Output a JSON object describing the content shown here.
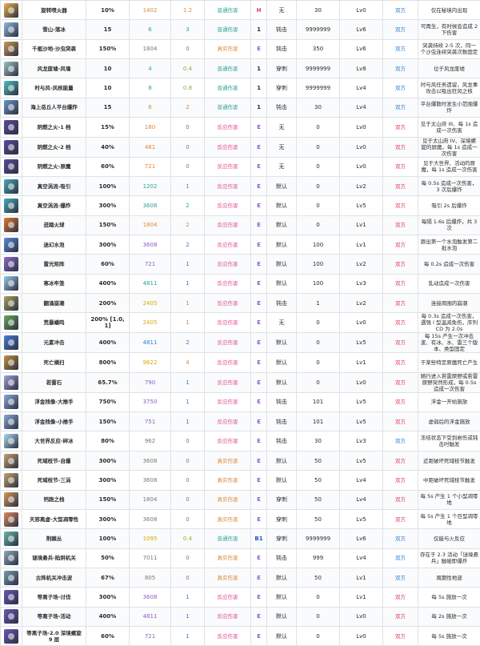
{
  "colors": {
    "orange": "#e0863a",
    "teal": "#2aa39a",
    "green": "#7cb342",
    "red": "#e0405a",
    "pink": "#e05290",
    "purple": "#8a5fc8",
    "blue": "#2f7fd8",
    "yellow": "#d9a800",
    "gray": "#777777",
    "black": "#2b2b2b",
    "darkblue": "#2a52be"
  },
  "rows": [
    {
      "icon": "fire-sparkle-icon",
      "iconColor": "#f0b050",
      "name": "旋转喷火器",
      "pct": "10%",
      "num": "1402",
      "numColor": "orange",
      "mult": "1.2",
      "multColor": "orange",
      "dmg": "普通伤害",
      "dmgColor": "teal",
      "elem": "H",
      "elemColor": "red",
      "hit": "无",
      "val": "30",
      "lv": "Lv0",
      "side": "双方",
      "sideColor": "blue",
      "note": "仅在秘境内出现"
    },
    {
      "icon": "snow-fall-icon",
      "iconColor": "#8fb8e0",
      "name": "雪山-落冰",
      "pct": "15",
      "num": "6",
      "numColor": "teal",
      "mult": "3",
      "multColor": "teal",
      "dmg": "普通伤害",
      "dmgColor": "teal",
      "elem": "1",
      "elemColor": "black",
      "hit": "钝击",
      "val": "9999999",
      "lv": "Lv6",
      "side": "双方",
      "sideColor": "blue",
      "note": "可再生，有时候会造成 2 下伤害"
    },
    {
      "icon": "sand-worm-icon",
      "iconColor": "#c89850",
      "name": "千柩沙地-沙虫突袭",
      "pct": "150%",
      "num": "1804",
      "numColor": "gray",
      "mult": "0",
      "multColor": "gray",
      "dmg": "真实伤害",
      "dmgColor": "orange",
      "elem": "E",
      "elemColor": "purple",
      "hit": "钝击",
      "val": "350",
      "lv": "Lv6",
      "side": "双方",
      "sideColor": "blue",
      "note": "突袭持续 2-5 次，同一个沙虫连续突袭次数固定"
    },
    {
      "icon": "wind-wall-icon",
      "iconColor": "#9ac4c0",
      "name": "风龙废墟-风墙",
      "pct": "10",
      "num": "4",
      "numColor": "teal",
      "mult": "0.4",
      "multColor": "green",
      "dmg": "普通伤害",
      "dmgColor": "teal",
      "elem": "1",
      "elemColor": "black",
      "hit": "穿刺",
      "val": "9999999",
      "lv": "Lv8",
      "side": "双方",
      "sideColor": "blue",
      "note": "位于风龙废墟"
    },
    {
      "icon": "wind-core-icon",
      "iconColor": "#4fc0c0",
      "name": "时与风-风核能量",
      "pct": "10",
      "num": "8",
      "numColor": "teal",
      "mult": "0.8",
      "multColor": "green",
      "dmg": "普通伤害",
      "dmgColor": "teal",
      "elem": "1",
      "elemColor": "black",
      "hit": "穿刺",
      "val": "9999999",
      "lv": "Lv4",
      "side": "双方",
      "sideColor": "blue",
      "note": "时与风任务遗留，风龙事攻击以吸出狂风之核"
    },
    {
      "icon": "sea-platform-icon",
      "iconColor": "#6a98c8",
      "name": "海上岳丘人平台爆炸",
      "pct": "15",
      "num": "6",
      "numColor": "orange",
      "mult": "2",
      "multColor": "orange",
      "dmg": "普通伤害",
      "dmgColor": "teal",
      "elem": "1",
      "elemColor": "black",
      "hit": "钝击",
      "val": "30",
      "lv": "Lv4",
      "side": "双方",
      "sideColor": "blue",
      "note": "平台爆散时发生小范围爆炸"
    },
    {
      "icon": "dark-fire-icon",
      "iconColor": "#5a4a9a",
      "name": "阴燃之火-1 档",
      "pct": "15%",
      "num": "180",
      "numColor": "orange",
      "mult": "0",
      "multColor": "gray",
      "dmg": "反应伤害",
      "dmgColor": "pink",
      "elem": "E",
      "elemColor": "purple",
      "hit": "无",
      "val": "0",
      "lv": "Lv0",
      "side": "双方",
      "sideColor": "red",
      "note": "见于太山府 III、每 1s 造成一次伤害"
    },
    {
      "icon": "dark-fire-icon",
      "iconColor": "#5a4a9a",
      "name": "阴燃之火-2 档",
      "pct": "40%",
      "num": "481",
      "numColor": "orange",
      "mult": "0",
      "multColor": "gray",
      "dmg": "反应伤害",
      "dmgColor": "pink",
      "elem": "E",
      "elemColor": "purple",
      "hit": "无",
      "val": "0",
      "lv": "Lv0",
      "side": "双方",
      "sideColor": "red",
      "note": "见于太山府 IV、深境螺旋的屏魔，每 1s 造成一次伤害"
    },
    {
      "icon": "dark-fire-icon",
      "iconColor": "#5a4a9a",
      "name": "阴燃之火-原魔",
      "pct": "60%",
      "num": "721",
      "numColor": "orange",
      "mult": "0",
      "multColor": "gray",
      "dmg": "反应伤害",
      "dmgColor": "pink",
      "elem": "E",
      "elemColor": "purple",
      "hit": "无",
      "val": "0",
      "lv": "Lv0",
      "side": "双方",
      "sideColor": "red",
      "note": "见于大世界、活动的原魔，每 1s 造成一次伤害"
    },
    {
      "icon": "void-vortex-icon",
      "iconColor": "#4aa8b8",
      "name": "真空涡流-吸引",
      "pct": "100%",
      "num": "1202",
      "numColor": "teal",
      "mult": "1",
      "multColor": "teal",
      "dmg": "反应伤害",
      "dmgColor": "pink",
      "elem": "E",
      "elemColor": "purple",
      "hit": "默认",
      "val": "0",
      "lv": "Lv2",
      "side": "双方",
      "sideColor": "red",
      "note": "每 0.5s 造成一次伤害，3 次后爆炸"
    },
    {
      "icon": "void-vortex-icon",
      "iconColor": "#4aa8b8",
      "name": "真空涡流-爆炸",
      "pct": "300%",
      "num": "3608",
      "numColor": "teal",
      "mult": "2",
      "multColor": "teal",
      "dmg": "反应伤害",
      "dmgColor": "pink",
      "elem": "E",
      "elemColor": "purple",
      "hit": "默认",
      "val": "0",
      "lv": "Lv5",
      "side": "双方",
      "sideColor": "red",
      "note": "吸引 2s 后爆炸"
    },
    {
      "icon": "fireball-icon",
      "iconColor": "#e07a30",
      "name": "迸踏火球",
      "pct": "150%",
      "num": "1804",
      "numColor": "orange",
      "mult": "2",
      "multColor": "orange",
      "dmg": "反应伤害",
      "dmgColor": "pink",
      "elem": "E",
      "elemColor": "purple",
      "hit": "默认",
      "val": "0",
      "lv": "Lv1",
      "side": "双方",
      "sideColor": "red",
      "note": "每隔 1.6s 后爆炸，共 3 次"
    },
    {
      "icon": "water-bubble-icon",
      "iconColor": "#5a8ad8",
      "name": "迷幻水泡",
      "pct": "300%",
      "num": "3608",
      "numColor": "purple",
      "mult": "2",
      "multColor": "blue",
      "dmg": "反应伤害",
      "dmgColor": "pink",
      "elem": "E",
      "elemColor": "purple",
      "hit": "默认",
      "val": "100",
      "lv": "Lv1",
      "side": "双方",
      "sideColor": "red",
      "note": "跟出第一个水泡触发第二批水泡"
    },
    {
      "icon": "thunder-array-icon",
      "iconColor": "#8a6ac8",
      "name": "雷光矩阵",
      "pct": "60%",
      "num": "721",
      "numColor": "purple",
      "mult": "1",
      "multColor": "blue",
      "dmg": "反应伤害",
      "dmgColor": "pink",
      "elem": "E",
      "elemColor": "purple",
      "hit": "默认",
      "val": "100",
      "lv": "Lv2",
      "side": "双方",
      "sideColor": "red",
      "note": "每 0.2s 造成一次伤害"
    },
    {
      "icon": "ice-cage-icon",
      "iconColor": "#9ac8e8",
      "name": "寒冰牢笼",
      "pct": "400%",
      "num": "4811",
      "numColor": "teal",
      "mult": "1",
      "multColor": "blue",
      "dmg": "反应伤害",
      "dmgColor": "pink",
      "elem": "E",
      "elemColor": "purple",
      "hit": "默认",
      "val": "100",
      "lv": "Lv3",
      "side": "双方",
      "sideColor": "red",
      "note": "乱动造成一次伤害"
    },
    {
      "icon": "rock-fall-icon",
      "iconColor": "#a8a060",
      "name": "翻涌崩潮",
      "pct": "200%",
      "num": "2405",
      "numColor": "yellow",
      "mult": "1",
      "multColor": "orange",
      "dmg": "反应伤害",
      "dmgColor": "pink",
      "elem": "E",
      "elemColor": "purple",
      "hit": "钝击",
      "val": "1",
      "lv": "Lv2",
      "side": "双方",
      "sideColor": "red",
      "note": "连接周围的崩潮"
    },
    {
      "icon": "thorn-bush-icon",
      "iconColor": "#6aa858",
      "name": "荒暴蟠鸣",
      "pct": "200% [1.0,1]",
      "num": "2405",
      "numColor": "yellow",
      "mult": "1",
      "multColor": "orange",
      "dmg": "反应伤害",
      "dmgColor": "pink",
      "elem": "E",
      "elemColor": "purple",
      "hit": "无",
      "val": "0",
      "lv": "Lv0",
      "side": "双方",
      "sideColor": "red",
      "note": "每 0.3s 造成一次伤害，遇强 I 型温减免伤，序列 CD 为 2.0s"
    },
    {
      "icon": "element-strike-icon",
      "iconColor": "#4a7ad8",
      "name": "元素冲击",
      "pct": "400%",
      "num": "4811",
      "numColor": "blue",
      "mult": "2",
      "multColor": "blue",
      "dmg": "反应伤害",
      "dmgColor": "pink",
      "elem": "E",
      "elemColor": "purple",
      "hit": "默认",
      "val": "0",
      "lv": "Lv5",
      "side": "双方",
      "sideColor": "red",
      "note": "每 15s 产生一次冲击波、有冰、水、雷三个版本、类型固定"
    },
    {
      "icon": "death-dash-icon",
      "iconColor": "#c89040",
      "name": "死亡横扫",
      "pct": "800%",
      "num": "9622",
      "numColor": "yellow",
      "mult": "4",
      "multColor": "orange",
      "dmg": "反应伤害",
      "dmgColor": "pink",
      "elem": "E",
      "elemColor": "purple",
      "hit": "默认",
      "val": "0",
      "lv": "Lv1",
      "side": "双方",
      "sideColor": "red",
      "note": "于某些特定原魔死亡产生"
    },
    {
      "icon": "grass-thunder-icon",
      "iconColor": "#a0a0d8",
      "name": "若雷石",
      "pct": "65.7%",
      "num": "790",
      "numColor": "purple",
      "mult": "1",
      "multColor": "blue",
      "dmg": "反应伤害",
      "dmgColor": "pink",
      "elem": "E",
      "elemColor": "purple",
      "hit": "默认",
      "val": "0",
      "lv": "Lv0",
      "side": "双方",
      "sideColor": "red",
      "note": "随行进入若雷原野或若雷原野突然形成，每 0.5s 造成一次伤害"
    },
    {
      "icon": "floating-rock-icon",
      "iconColor": "#8aa8d8",
      "name": "浮金残像-大推手",
      "pct": "750%",
      "num": "3750",
      "numColor": "purple",
      "mult": "1",
      "multColor": "blue",
      "dmg": "反应伤害",
      "dmgColor": "pink",
      "elem": "E",
      "elemColor": "purple",
      "hit": "钝击",
      "val": "101",
      "lv": "Lv5",
      "side": "双方",
      "sideColor": "red",
      "note": "浮金一开始施放"
    },
    {
      "icon": "floating-rock-icon",
      "iconColor": "#8aa8d8",
      "name": "浮金残像-小推手",
      "pct": "150%",
      "num": "751",
      "numColor": "purple",
      "mult": "1",
      "multColor": "blue",
      "dmg": "反应伤害",
      "dmgColor": "pink",
      "elem": "E",
      "elemColor": "purple",
      "hit": "钝击",
      "val": "101",
      "lv": "Lv5",
      "side": "双方",
      "sideColor": "red",
      "note": "虚弱后的浮金施放"
    },
    {
      "icon": "frost-orbs-icon",
      "iconColor": "#b0d8f0",
      "name": "大世界反应-碎冰",
      "pct": "80%",
      "num": "962",
      "numColor": "gray",
      "mult": "0",
      "multColor": "gray",
      "dmg": "反应伤害",
      "dmgColor": "pink",
      "elem": "E",
      "elemColor": "purple",
      "hit": "钝击",
      "val": "30",
      "lv": "Lv3",
      "side": "双方",
      "sideColor": "blue",
      "note": "冻结状态下受到岩伤或钝击时触发"
    },
    {
      "icon": "death-domain-icon",
      "iconColor": "#c8a070",
      "name": "死域枝节-自爆",
      "pct": "300%",
      "num": "3608",
      "numColor": "gray",
      "mult": "0",
      "multColor": "gray",
      "dmg": "真实伤害",
      "dmgColor": "orange",
      "elem": "E",
      "elemColor": "purple",
      "hit": "默认",
      "val": "50",
      "lv": "Lv5",
      "side": "双方",
      "sideColor": "red",
      "note": "近距破坏死域枝节触发"
    },
    {
      "icon": "death-domain-icon",
      "iconColor": "#c8a070",
      "name": "死域枝节-三涓",
      "pct": "300%",
      "num": "3608",
      "numColor": "gray",
      "mult": "0",
      "multColor": "gray",
      "dmg": "真实伤害",
      "dmgColor": "orange",
      "elem": "E",
      "elemColor": "purple",
      "hit": "默认",
      "val": "50",
      "lv": "Lv4",
      "side": "双方",
      "sideColor": "red",
      "note": "中距破坏死域枝节触发"
    },
    {
      "icon": "shell-trap-icon",
      "iconColor": "#d89858",
      "name": "钙跑之栈",
      "pct": "150%",
      "num": "1804",
      "numColor": "gray",
      "mult": "0",
      "multColor": "gray",
      "dmg": "真实伤害",
      "dmgColor": "orange",
      "elem": "E",
      "elemColor": "purple",
      "hit": "穿刺",
      "val": "50",
      "lv": "Lv4",
      "side": "双方",
      "sideColor": "red",
      "note": "每 5s 产生 1 个小型凋零地"
    },
    {
      "icon": "wither-zone-icon",
      "iconColor": "#e08a60",
      "name": "天邪离虚-大型凋零性",
      "pct": "300%",
      "num": "3608",
      "numColor": "gray",
      "mult": "0",
      "multColor": "gray",
      "dmg": "真实伤害",
      "dmgColor": "orange",
      "elem": "E",
      "elemColor": "purple",
      "hit": "穿刺",
      "val": "50",
      "lv": "Lv5",
      "side": "双方",
      "sideColor": "red",
      "note": "每 5s 产生 1 个巨型凋零地"
    },
    {
      "icon": "bramble-icon",
      "iconColor": "#6ab8a8",
      "name": "荆棘丛",
      "pct": "100%",
      "num": "1095",
      "numColor": "yellow",
      "mult": "0.4",
      "multColor": "green",
      "dmg": "普通伤害",
      "dmgColor": "teal",
      "elem": "B1",
      "elemColor": "darkblue",
      "hit": "穿刺",
      "val": "9999999",
      "lv": "Lv6",
      "side": "双方",
      "sideColor": "blue",
      "note": "仅能与火反应"
    },
    {
      "icon": "cannon-icon",
      "iconColor": "#90a8c0",
      "name": "谜境悬兵-陷阱机关",
      "pct": "50%",
      "num": "7011",
      "numColor": "gray",
      "mult": "0",
      "multColor": "gray",
      "dmg": "真实伤害",
      "dmgColor": "orange",
      "elem": "E",
      "elemColor": "purple",
      "hit": "钝击",
      "val": "999",
      "lv": "Lv4",
      "side": "双方",
      "sideColor": "blue",
      "note": "存在于 2.3 活动「谜境悬兵」触碰即爆炸"
    },
    {
      "icon": "mech-cannon-icon",
      "iconColor": "#7a9ab0",
      "name": "古阵机关冲击波",
      "pct": "67%",
      "num": "805",
      "numColor": "gray",
      "mult": "0",
      "multColor": "gray",
      "dmg": "真实伤害",
      "dmgColor": "orange",
      "elem": "E",
      "elemColor": "purple",
      "hit": "默认",
      "val": "50",
      "lv": "Lv1",
      "side": "双方",
      "sideColor": "blue",
      "note": "周期性地波"
    },
    {
      "icon": "teleport-field-icon",
      "iconColor": "#6a58b8",
      "name": "等离子场-讨伐",
      "pct": "300%",
      "num": "3608",
      "numColor": "purple",
      "mult": "1",
      "multColor": "blue",
      "dmg": "反应伤害",
      "dmgColor": "pink",
      "elem": "E",
      "elemColor": "purple",
      "hit": "默认",
      "val": "0",
      "lv": "Lv1",
      "side": "双方",
      "sideColor": "red",
      "note": "每 5s 施放一次"
    },
    {
      "icon": "teleport-field-icon",
      "iconColor": "#6a58b8",
      "name": "等离子场-活动",
      "pct": "400%",
      "num": "4811",
      "numColor": "purple",
      "mult": "1",
      "multColor": "blue",
      "dmg": "反应伤害",
      "dmgColor": "pink",
      "elem": "E",
      "elemColor": "purple",
      "hit": "默认",
      "val": "0",
      "lv": "Lv0",
      "side": "双方",
      "sideColor": "red",
      "note": "每 2s 施放一次"
    },
    {
      "icon": "teleport-field-icon",
      "iconColor": "#6a58b8",
      "name": "等离子场-2.0 深境螺旋 9 层",
      "pct": "60%",
      "num": "721",
      "numColor": "purple",
      "mult": "1",
      "multColor": "blue",
      "dmg": "反应伤害",
      "dmgColor": "pink",
      "elem": "E",
      "elemColor": "purple",
      "hit": "默认",
      "val": "0",
      "lv": "Lv0",
      "side": "双方",
      "sideColor": "red",
      "note": "每 5s 施放一次"
    }
  ]
}
